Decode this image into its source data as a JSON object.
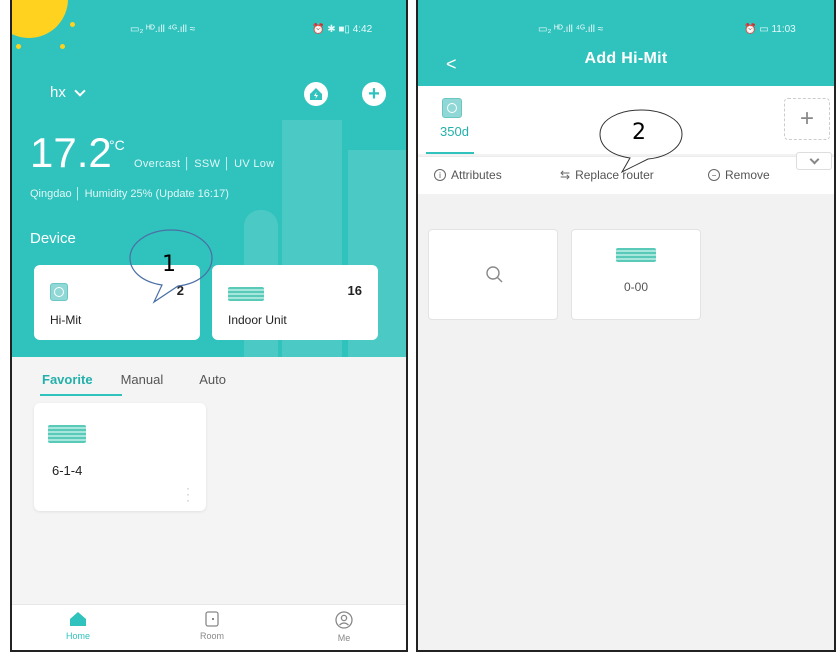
{
  "left": {
    "statusbar": {
      "left": "▭₂ ᴴᴰ.ıll ⁴ᴳ.ıll ≈",
      "right": "⏰ ✱ ■▯ 4:42"
    },
    "home_selector": "hx",
    "weather": {
      "temperature": "17.2",
      "unit": "°C",
      "conditions": "Overcast │ SSW │ UV Low",
      "location_line": "Qingdao │ Humidity 25%  (Update 16:17)"
    },
    "device_section_title": "Device",
    "devices": [
      {
        "name": "Hi-Mit",
        "count": "2",
        "icon": "hub-icon"
      },
      {
        "name": "Indoor Unit",
        "count": "16",
        "icon": "ac-unit-icon"
      }
    ],
    "tabs": [
      {
        "label": "Favorite",
        "active": true
      },
      {
        "label": "Manual",
        "active": false
      },
      {
        "label": "Auto",
        "active": false
      }
    ],
    "favorite_card": {
      "name": "6-1-4",
      "icon": "ac-unit-icon"
    },
    "bottom_nav": [
      {
        "label": "Home",
        "icon": "home-icon",
        "active": true
      },
      {
        "label": "Room",
        "icon": "door-icon",
        "active": false
      },
      {
        "label": "Me",
        "icon": "user-icon",
        "active": false
      }
    ],
    "callout_number": "1"
  },
  "right": {
    "statusbar": {
      "left": "▭₂ ᴴᴰ.ıll ⁴ᴳ.ıll ≈",
      "right": "⏰ ▭ 11:03"
    },
    "back_label": "<",
    "title": "Add Hi-Mit",
    "device_tab": {
      "label": "350d",
      "icon": "hub-icon"
    },
    "add_label": "+",
    "actions": [
      {
        "label": "Attributes",
        "icon": "info-icon"
      },
      {
        "label": "Replace router",
        "icon": "swap-icon"
      },
      {
        "label": "Remove",
        "icon": "minus-circle-icon"
      }
    ],
    "cards": [
      {
        "name": "",
        "icon": "search-icon"
      },
      {
        "name": "0-00",
        "icon": "ac-unit-icon"
      }
    ],
    "callout_number": "2"
  },
  "colors": {
    "accent": "#30c2bd",
    "sun": "#ffd21f"
  }
}
